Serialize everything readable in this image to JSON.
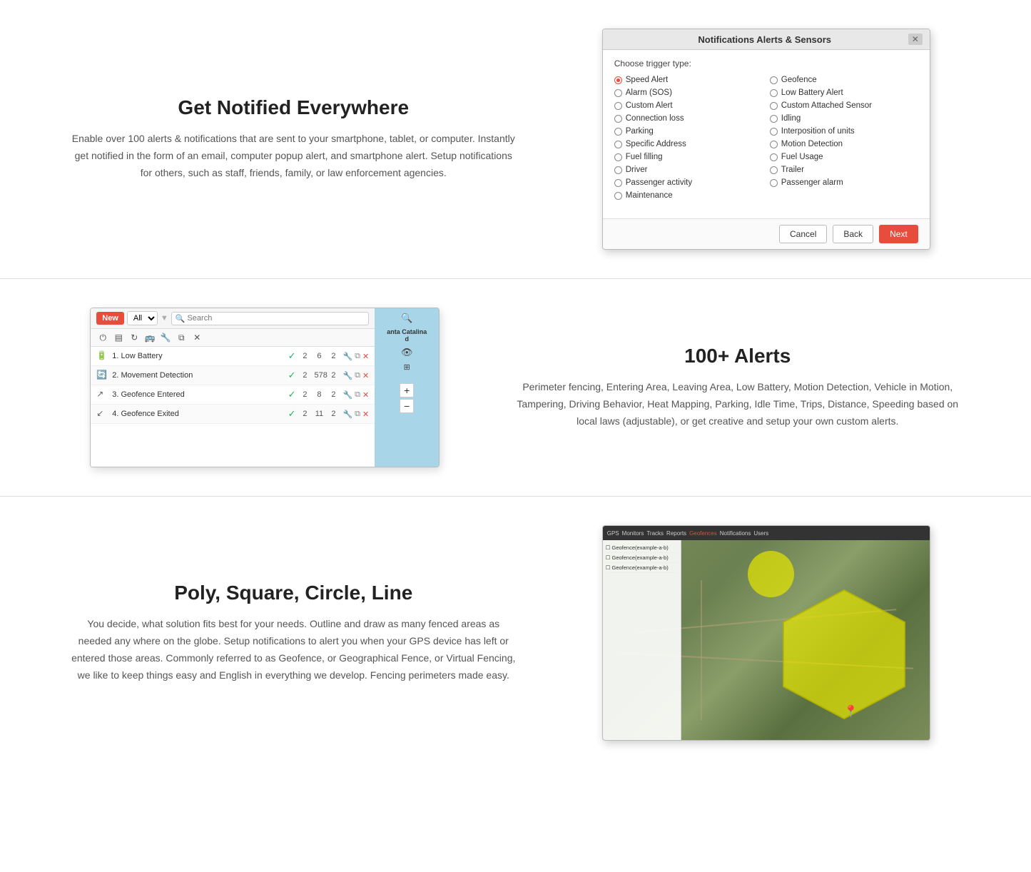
{
  "section1": {
    "title": "Get Notified Everywhere",
    "description": "Enable over 100 alerts & notifications that are sent to your smartphone, tablet, or computer. Instantly get notified in the form of an email, computer popup alert, and smartphone alert. Setup notifications for others, such as staff, friends, family, or law enforcement agencies.",
    "modal": {
      "title": "Notifications Alerts & Sensors",
      "subtitle": "Choose trigger type:",
      "options": [
        {
          "label": "Speed Alert",
          "selected": true
        },
        {
          "label": "Geofence",
          "selected": false
        },
        {
          "label": "Alarm (SOS)",
          "selected": false
        },
        {
          "label": "Low Battery Alert",
          "selected": false
        },
        {
          "label": "Custom Alert",
          "selected": false
        },
        {
          "label": "Custom Attached Sensor",
          "selected": false
        },
        {
          "label": "Connection loss",
          "selected": false
        },
        {
          "label": "Idling",
          "selected": false
        },
        {
          "label": "Parking",
          "selected": false
        },
        {
          "label": "Interposition of units",
          "selected": false
        },
        {
          "label": "Specific Address",
          "selected": false
        },
        {
          "label": "Motion Detection",
          "selected": false
        },
        {
          "label": "Fuel filling",
          "selected": false
        },
        {
          "label": "Fuel Usage",
          "selected": false
        },
        {
          "label": "Driver",
          "selected": false
        },
        {
          "label": "Trailer",
          "selected": false
        },
        {
          "label": "Passenger activity",
          "selected": false
        },
        {
          "label": "Passenger alarm",
          "selected": false
        },
        {
          "label": "Maintenance",
          "selected": false
        }
      ],
      "buttons": {
        "cancel": "Cancel",
        "back": "Back",
        "next": "Next"
      }
    }
  },
  "section2": {
    "title": "100+ Alerts",
    "description": "Perimeter fencing, Entering Area, Leaving Area, Low Battery, Motion Detection, Vehicle in Motion, Tampering, Driving Behavior, Heat Mapping, Parking, Idle Time, Trips, Distance, Speeding based on local laws (adjustable), or get creative and setup your own custom alerts.",
    "toolbar": {
      "new_label": "New",
      "filter_options": [
        "All"
      ],
      "search_placeholder": "Search"
    },
    "alerts": [
      {
        "index": "1.",
        "name": "Low Battery",
        "checked": true,
        "num1": "2",
        "num2": "6",
        "num3": "2"
      },
      {
        "index": "2.",
        "name": "Movement Detection",
        "checked": true,
        "num1": "2",
        "num2": "578",
        "num3": "2"
      },
      {
        "index": "3.",
        "name": "Geofence Entered",
        "checked": true,
        "num1": "2",
        "num2": "8",
        "num3": "2"
      },
      {
        "index": "4.",
        "name": "Geofence Exited",
        "checked": true,
        "num1": "2",
        "num2": "11",
        "num3": "2"
      }
    ],
    "map_label": "anta Catalina d"
  },
  "section3": {
    "title": "Poly, Square, Circle, Line",
    "description": "You decide, what solution fits best for your needs. Outline and draw as many fenced areas as needed any where on the globe. Setup notifications to alert you when your GPS device has left or entered those areas. Commonly referred to as Geofence, or Geographical Fence, or Virtual Fencing, we like to keep things easy and English in everything we develop. Fencing perimeters made easy."
  }
}
